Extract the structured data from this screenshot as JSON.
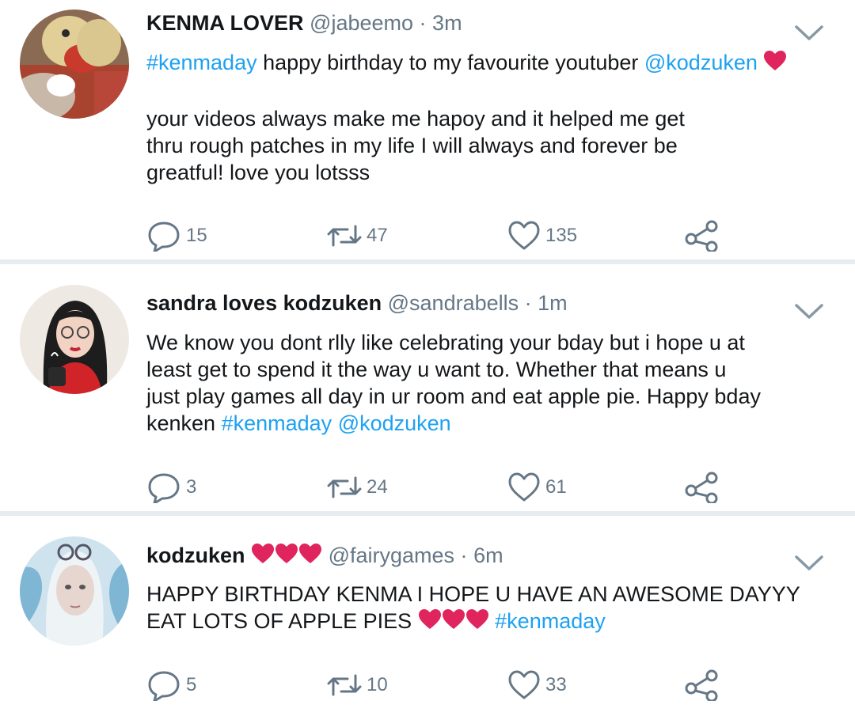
{
  "colors": {
    "link": "#1da1f2",
    "muted": "#657786",
    "text": "#14171a",
    "heart": "#e0245e",
    "separator": "#e6ecf0"
  },
  "tweets": [
    {
      "name": "KENMA LOVER",
      "handle": "@jabeemo",
      "dot": "·",
      "time": "3m",
      "lines": [
        [
          {
            "text": "#kenmaday",
            "type": "link"
          },
          {
            "text": " happy birthday to my favourite youtuber ",
            "type": "text"
          },
          {
            "text": "@kodzuken",
            "type": "link"
          },
          {
            "text": " ",
            "type": "text"
          }
        ],
        [],
        [
          {
            "text": "your videos always make me hapoy and it helped me get",
            "type": "text"
          }
        ],
        [
          {
            "text": "thru rough patches in my life I will always and forever be",
            "type": "text"
          }
        ],
        [
          {
            "text": "greatful! love you lotsss",
            "type": "text"
          }
        ]
      ],
      "reply_count": "15",
      "retweet_count": "47",
      "like_count": "135"
    },
    {
      "name": "sandra loves kodzuken",
      "handle": "@sandrabells",
      "dot": "·",
      "time": "1m",
      "lines": [
        [
          {
            "text": "We know you dont rlly like celebrating your bday but i hope u at",
            "type": "text"
          }
        ],
        [
          {
            "text": "least get to spend it the way u want to. Whether that means u",
            "type": "text"
          }
        ],
        [
          {
            "text": "just play games all day in ur room and eat apple pie. Happy bday",
            "type": "text"
          }
        ],
        [
          {
            "text": "kenken ",
            "type": "text"
          },
          {
            "text": "#kenmaday",
            "type": "link"
          },
          {
            "text": " ",
            "type": "text"
          },
          {
            "text": "@kodzuken",
            "type": "link"
          }
        ]
      ],
      "reply_count": "3",
      "retweet_count": "24",
      "like_count": "61"
    },
    {
      "name": "kodzuken",
      "handle": "@fairygames",
      "dot": "·",
      "time": "6m",
      "lines": [
        [
          {
            "text": "HAPPY BIRTHDAY KENMA I HOPE U HAVE AN AWESOME DAYYY",
            "type": "text"
          }
        ],
        [
          {
            "text": "EAT LOTS OF APPLE PIES ",
            "type": "text"
          },
          {
            "text": " ",
            "type": "text"
          },
          {
            "text": "#kenmaday",
            "type": "link"
          }
        ]
      ],
      "reply_count": "5",
      "retweet_count": "10",
      "like_count": "33"
    }
  ]
}
